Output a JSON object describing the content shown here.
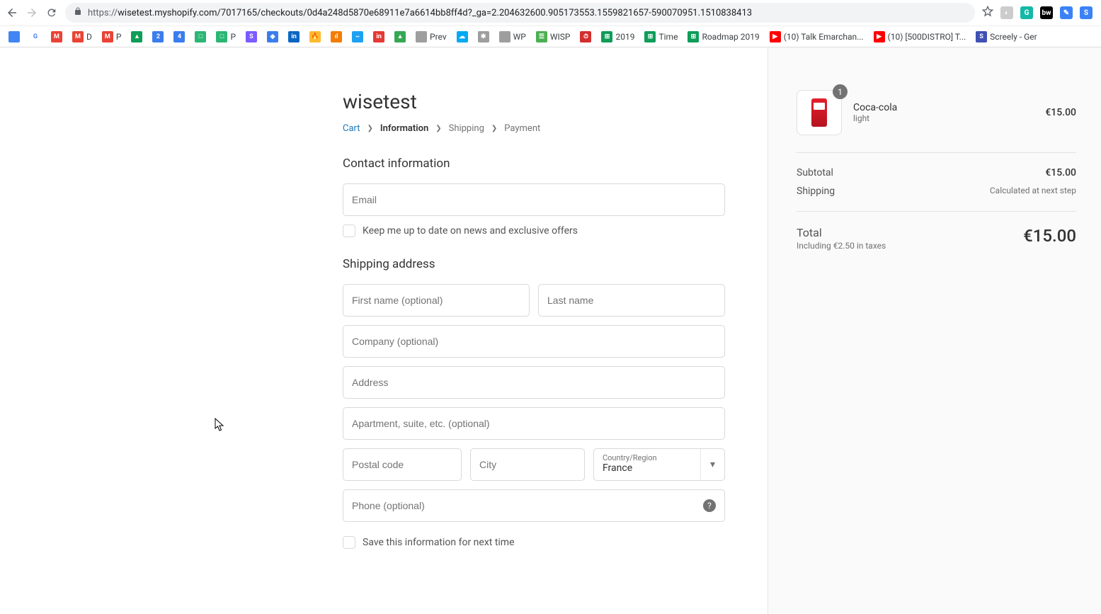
{
  "browser": {
    "url_proto": "https://",
    "url_rest": "wisetest.myshopify.com/7017165/checkouts/0d4a248d5870e68911e7a6614bb8ff4d?_ga=2.204632600.905173553.1559821657-590070951.1510838413",
    "bookmarks": [
      {
        "label": "",
        "color": "#4285f4"
      },
      {
        "label": "",
        "color": "#fff",
        "text": "G",
        "tc": "#4285f4"
      },
      {
        "label": "",
        "color": "#ea4335",
        "text": "M"
      },
      {
        "label": "D",
        "color": "#ea4335",
        "text": "M"
      },
      {
        "label": "P",
        "color": "#ea4335",
        "text": "M"
      },
      {
        "label": "",
        "color": "#0f9d58",
        "text": "▲"
      },
      {
        "label": "",
        "color": "#3b7ded",
        "text": "2"
      },
      {
        "label": "",
        "color": "#3b7ded",
        "text": "4"
      },
      {
        "label": "",
        "color": "#2bb673",
        "text": "□"
      },
      {
        "label": "P",
        "color": "#2bb673",
        "text": "□"
      },
      {
        "label": "",
        "color": "#7b5cff",
        "text": "S"
      },
      {
        "label": "",
        "color": "#3b7ded",
        "text": "◆"
      },
      {
        "label": "",
        "color": "#0a66c2",
        "text": "in"
      },
      {
        "label": "",
        "color": "#fdbb2d",
        "text": "🔥"
      },
      {
        "label": "",
        "color": "#f57c00",
        "text": "ıl"
      },
      {
        "label": "",
        "color": "#1da1f2",
        "text": "~"
      },
      {
        "label": "",
        "color": "#e53935",
        "text": "in"
      },
      {
        "label": "",
        "color": "#34a853",
        "text": "▲"
      },
      {
        "label": "Prev",
        "color": "#9e9e9e",
        "text": ""
      },
      {
        "label": "",
        "color": "#03a9f4",
        "text": "☁"
      },
      {
        "label": "",
        "color": "#9e9e9e",
        "text": "✱"
      },
      {
        "label": "WP",
        "color": "#9e9e9e",
        "text": ""
      },
      {
        "label": "WISP",
        "color": "#4caf50",
        "text": "☰"
      },
      {
        "label": "",
        "color": "#d32f2f",
        "text": "⏱"
      },
      {
        "label": "2019",
        "color": "#0f9d58",
        "text": "⊞"
      },
      {
        "label": "Time",
        "color": "#0f9d58",
        "text": "⊞"
      },
      {
        "label": "Roadmap 2019",
        "color": "#0f9d58",
        "text": "⊞"
      },
      {
        "label": "(10) Talk Emarchan...",
        "color": "#ff0000",
        "text": "▶"
      },
      {
        "label": "(10) [500DISTRO] T...",
        "color": "#ff0000",
        "text": "▶"
      },
      {
        "label": "Screely - Ger",
        "color": "#3f51b5",
        "text": "S"
      }
    ]
  },
  "store_name": "wisetest",
  "breadcrumb": {
    "cart": "Cart",
    "info": "Information",
    "shipping": "Shipping",
    "payment": "Payment"
  },
  "contact": {
    "title": "Contact information",
    "email_placeholder": "Email",
    "news_label": "Keep me up to date on news and exclusive offers"
  },
  "shipping_addr": {
    "title": "Shipping address",
    "first_name": "First name (optional)",
    "last_name": "Last name",
    "company": "Company (optional)",
    "address": "Address",
    "apartment": "Apartment, suite, etc. (optional)",
    "postal": "Postal code",
    "city": "City",
    "country_label": "Country/Region",
    "country_value": "France",
    "phone": "Phone (optional)",
    "save_label": "Save this information for next time"
  },
  "order": {
    "product_name": "Coca-cola",
    "product_variant": "light",
    "product_qty": "1",
    "product_price": "€15.00",
    "subtotal_label": "Subtotal",
    "subtotal_value": "€15.00",
    "shipping_label": "Shipping",
    "shipping_value": "Calculated at next step",
    "total_label": "Total",
    "total_tax": "Including €2.50 in taxes",
    "total_value": "€15.00"
  }
}
